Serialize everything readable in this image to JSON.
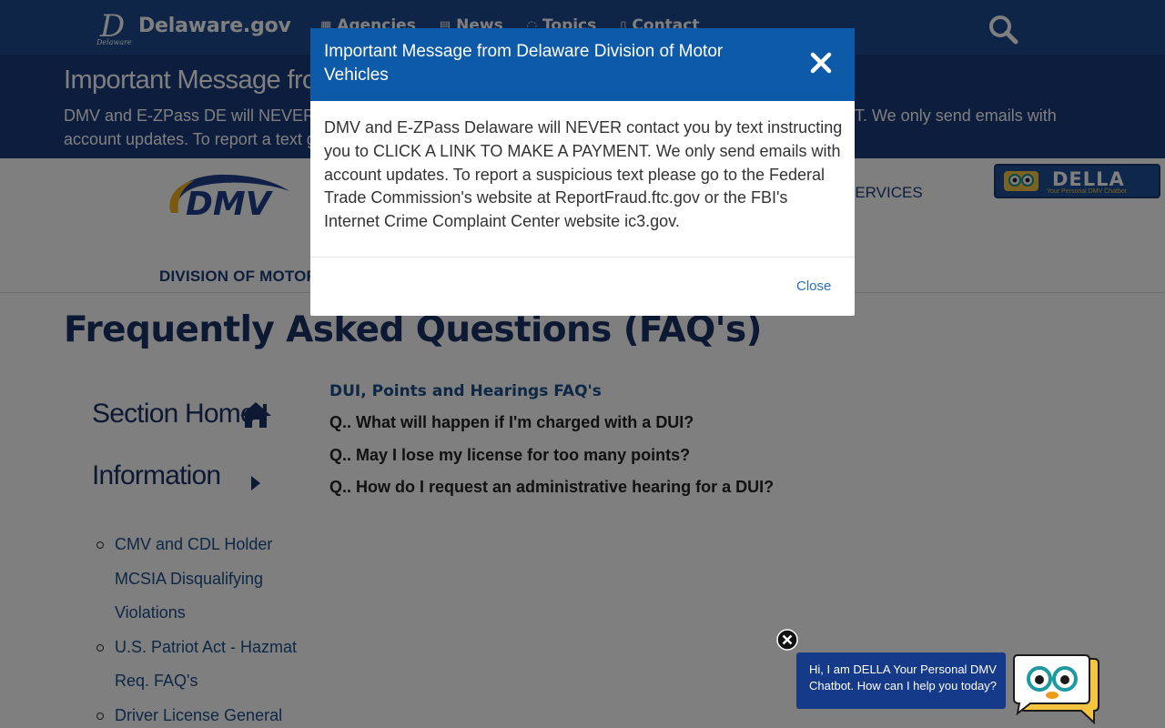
{
  "site": {
    "logo_text": "Delaware.gov",
    "logo_sub": "Delaware",
    "nav": [
      {
        "label": "Agencies",
        "icon": "building-icon"
      },
      {
        "label": "News",
        "icon": "newspaper-icon"
      },
      {
        "label": "Topics",
        "icon": "chat-icon"
      },
      {
        "label": "Contact",
        "icon": "phone-icon"
      }
    ]
  },
  "alert": {
    "title": "Important Message from Delaware Division of Motor Vehicles",
    "body": "DMV and E-ZPass DE will NEVER contact you by text instructing you to CLICK A LINK TO MAKE A PAYMENT. We only send emails with account updates. To report a text go to ReportFraud.ftc.gov"
  },
  "dmv_header": {
    "logo_text": "DMV",
    "services": "SERVICES",
    "della_label": "DELLA",
    "della_sub": "Your Personal DMV Chatbot",
    "division": "DIVISION OF MOTOR VEHICLES"
  },
  "page": {
    "title": "Frequently Asked Questions (FAQ's)",
    "sidebar": {
      "home": "Section Home",
      "info": "Information",
      "items": [
        "CMV and CDL Holder MCSIA Disqualifying Violations",
        "U.S. Patriot Act - Hazmat Req. FAQ's",
        "Driver License General"
      ]
    },
    "faq": {
      "heading": "DUI, Points and Hearings FAQ's",
      "questions": [
        "Q.. What will happen if I'm charged with a DUI?",
        "Q.. May I lose my license for too many points?",
        "Q.. How do I request an administrative hearing for a DUI?"
      ]
    }
  },
  "modal": {
    "title": "Important Message from Delaware Division of Motor Vehicles",
    "body": "DMV and E-ZPass Delaware will NEVER contact you by text instructing you to CLICK A LINK TO MAKE A PAYMENT. We only send emails with account updates. To report a suspicious text please go to the Federal Trade Commission's website at ReportFraud.ftc.gov or the FBI's Internet Crime Complaint Center website ic3.gov.",
    "close_label": "Close"
  },
  "chatbot": {
    "greeting": "Hi, I am DELLA Your Personal DMV Chatbot. How can I help you today?"
  },
  "colors": {
    "topbar": "#1d4a8f",
    "alert_bg": "#1b3a7a",
    "modal_header": "#0d5aa8",
    "title_navy": "#1a3366",
    "link_blue": "#1a4f8a",
    "chat_bubble": "#153a8a"
  }
}
